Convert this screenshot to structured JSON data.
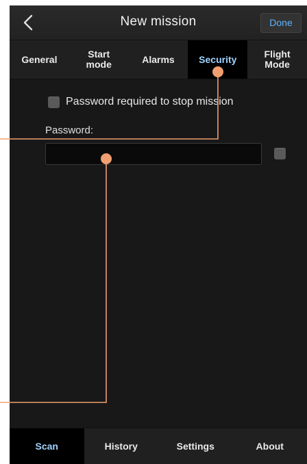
{
  "header": {
    "title": "New mission",
    "done_label": "Done",
    "back_icon": "chevron-left-icon"
  },
  "tabs": [
    {
      "label": "General",
      "active": false
    },
    {
      "label": "Start\nmode",
      "active": false
    },
    {
      "label": "Alarms",
      "active": false
    },
    {
      "label": "Security",
      "active": true
    },
    {
      "label": "Flight\nMode",
      "active": false
    }
  ],
  "security": {
    "require_password_label": "Password required to stop mission",
    "require_password_checked": false,
    "password_label": "Password:",
    "password_value": "",
    "show_password_checked": false
  },
  "bottom_nav": [
    {
      "label": "Scan",
      "active": true
    },
    {
      "label": "History",
      "active": false
    },
    {
      "label": "Settings",
      "active": false
    },
    {
      "label": "About",
      "active": false
    }
  ],
  "colors": {
    "accent": "#9fd3ff",
    "done_text": "#5fb4ff",
    "callout": "#f0a070"
  }
}
